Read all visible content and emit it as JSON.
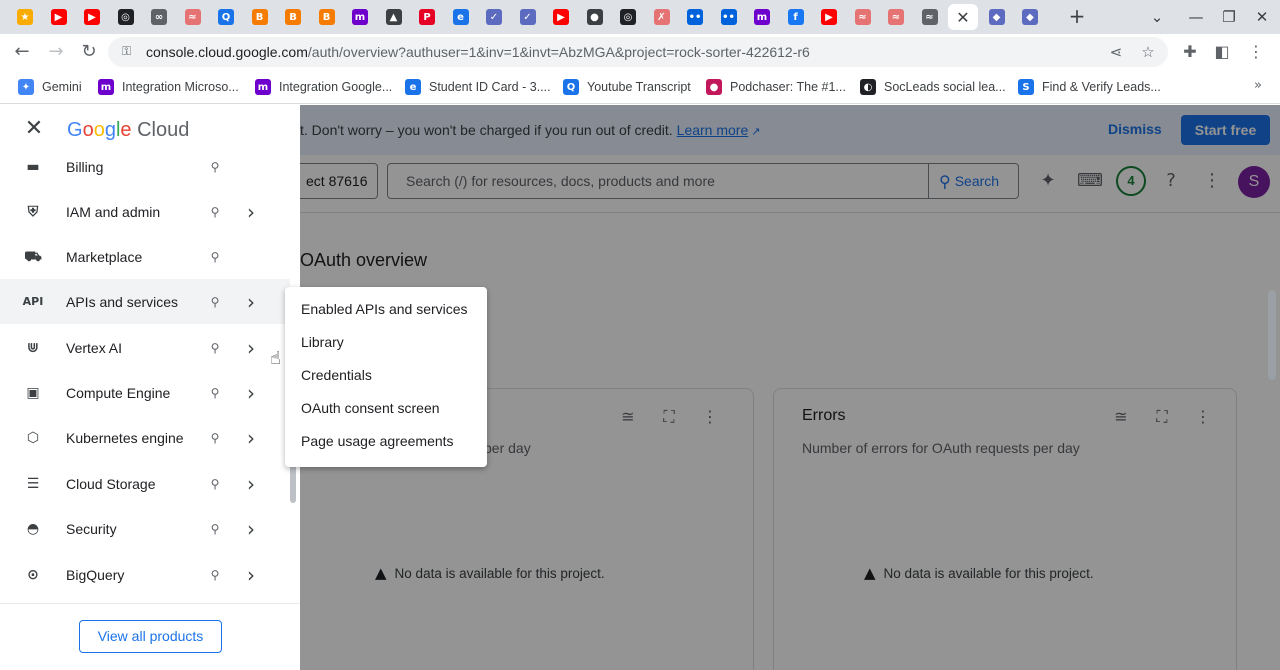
{
  "browser": {
    "tabs": [
      {
        "icon": "generic-favicon-icon",
        "color": "#f9ab00",
        "glyph": "★"
      },
      {
        "icon": "youtube-icon",
        "color": "#ff0000",
        "glyph": "▶"
      },
      {
        "icon": "youtube-icon",
        "color": "#ff0000",
        "glyph": "▶"
      },
      {
        "icon": "openai-icon",
        "color": "#202124",
        "glyph": "◎"
      },
      {
        "icon": "link-icon",
        "color": "#5f6368",
        "glyph": "∞"
      },
      {
        "icon": "generic-favicon-icon",
        "color": "#e57373",
        "glyph": "≈"
      },
      {
        "icon": "search-app-icon",
        "color": "#1a73e8",
        "glyph": "Q"
      },
      {
        "icon": "blogger-icon",
        "color": "#f57c00",
        "glyph": "B"
      },
      {
        "icon": "blogger-icon",
        "color": "#f57c00",
        "glyph": "B"
      },
      {
        "icon": "blogger-icon",
        "color": "#f57c00",
        "glyph": "B"
      },
      {
        "icon": "make-icon",
        "color": "#6d00cc",
        "glyph": "m"
      },
      {
        "icon": "flask-icon",
        "color": "#3c4043",
        "glyph": "▲"
      },
      {
        "icon": "pinterest-icon",
        "color": "#e60023",
        "glyph": "P"
      },
      {
        "icon": "generic-favicon-icon",
        "color": "#1a73e8",
        "glyph": "e"
      },
      {
        "icon": "generic-favicon-icon",
        "color": "#5c6bc0",
        "glyph": "✓"
      },
      {
        "icon": "generic-favicon-icon",
        "color": "#5c6bc0",
        "glyph": "✓"
      },
      {
        "icon": "youtube-icon",
        "color": "#ff0000",
        "glyph": "▶"
      },
      {
        "icon": "generic-favicon-icon",
        "color": "#3c4043",
        "glyph": "●"
      },
      {
        "icon": "openai-icon",
        "color": "#202124",
        "glyph": "◎"
      },
      {
        "icon": "generic-favicon-icon",
        "color": "#e57373",
        "glyph": "✗"
      },
      {
        "icon": "flickr-icon",
        "color": "#0063dc",
        "glyph": "••"
      },
      {
        "icon": "flickr-icon",
        "color": "#0063dc",
        "glyph": "••"
      },
      {
        "icon": "make-icon",
        "color": "#6d00cc",
        "glyph": "m"
      },
      {
        "icon": "facebook-icon",
        "color": "#1877f2",
        "glyph": "f"
      },
      {
        "icon": "youtube-icon",
        "color": "#ff0000",
        "glyph": "▶"
      },
      {
        "icon": "generic-favicon-icon",
        "color": "#e57373",
        "glyph": "≈"
      },
      {
        "icon": "generic-favicon-icon",
        "color": "#e57373",
        "glyph": "≈"
      },
      {
        "icon": "generic-favicon-icon",
        "color": "#5f6368",
        "glyph": "≈"
      },
      {
        "icon": "close-icon",
        "active": true,
        "glyph": "✕"
      },
      {
        "icon": "shield-icon",
        "color": "#5c6bc0",
        "glyph": "◆"
      },
      {
        "icon": "shield-icon",
        "color": "#5c6bc0",
        "glyph": "◆"
      }
    ],
    "url_host": "console.cloud.google.com",
    "url_rest": "/auth/overview?authuser=1&inv=1&invt=AbzMGA&project=rock-sorter-422612-r6",
    "bookmarks": [
      {
        "label": "Gemini",
        "icon": "gemini-icon",
        "color": "#4285f4",
        "glyph": "✦"
      },
      {
        "label": "Integration Microso...",
        "icon": "make-icon",
        "color": "#6d00cc",
        "glyph": "m"
      },
      {
        "label": "Integration Google...",
        "icon": "make-icon",
        "color": "#6d00cc",
        "glyph": "m"
      },
      {
        "label": "Student ID Card - 3....",
        "icon": "generic-favicon-icon",
        "color": "#1a73e8",
        "glyph": "e"
      },
      {
        "label": "Youtube Transcript",
        "icon": "search-app-icon",
        "color": "#1a73e8",
        "glyph": "Q"
      },
      {
        "label": "Podchaser: The #1...",
        "icon": "podchaser-icon",
        "color": "#c2185b",
        "glyph": "●"
      },
      {
        "label": "SocLeads social lea...",
        "icon": "socleads-icon",
        "color": "#202124",
        "glyph": "◐"
      },
      {
        "label": "Find & Verify Leads...",
        "icon": "generic-favicon-icon",
        "color": "#1a73e8",
        "glyph": "S"
      }
    ],
    "more_bookmarks": "»"
  },
  "banner": {
    "message": "t. Don't worry – you won't be charged if you run out of credit.",
    "learn_more": "Learn more",
    "dismiss": "Dismiss",
    "start_free": "Start free"
  },
  "appbar": {
    "project": "ect 87616",
    "search_placeholder": "Search (/) for resources, docs, products and more",
    "search_button": "Search",
    "notifications_count": "4",
    "avatar_letter": "S"
  },
  "page": {
    "title": "OAuth overview",
    "cards": [
      {
        "title": "",
        "subtitle": "per day",
        "no_data": "No data is available for this project."
      },
      {
        "title": "Errors",
        "subtitle": "Number of errors for OAuth requests per day",
        "no_data": "No data is available for this project."
      }
    ]
  },
  "drawer": {
    "logo": {
      "g": "G",
      "o1": "o",
      "o2": "o",
      "g2": "g",
      "l": "l",
      "e": "e",
      "cloud": "Cloud"
    },
    "items": [
      {
        "label": "Billing",
        "icon": "billing-icon",
        "glyph": "▬",
        "chevron": false
      },
      {
        "label": "IAM and admin",
        "icon": "iam-shield-icon",
        "glyph": "⛨",
        "chevron": true
      },
      {
        "label": "Marketplace",
        "icon": "marketplace-cart-icon",
        "glyph": "⛟",
        "chevron": false
      },
      {
        "label": "APIs and services",
        "icon": "api-icon",
        "glyph": "API",
        "chevron": true,
        "highlighted": true
      },
      {
        "label": "Vertex AI",
        "icon": "vertex-ai-icon",
        "glyph": "⋓",
        "chevron": true
      },
      {
        "label": "Compute Engine",
        "icon": "compute-chip-icon",
        "glyph": "▣",
        "chevron": true
      },
      {
        "label": "Kubernetes engine",
        "icon": "kubernetes-icon",
        "glyph": "⬡",
        "chevron": true
      },
      {
        "label": "Cloud Storage",
        "icon": "storage-icon",
        "glyph": "☰",
        "chevron": true
      },
      {
        "label": "Security",
        "icon": "security-shield-icon",
        "glyph": "◓",
        "chevron": true
      },
      {
        "label": "BigQuery",
        "icon": "bigquery-icon",
        "glyph": "⊙",
        "chevron": true
      }
    ],
    "view_all": "View all products"
  },
  "flyout": {
    "items": [
      "Enabled APIs and services",
      "Library",
      "Credentials",
      "OAuth consent screen",
      "Page usage agreements"
    ]
  }
}
